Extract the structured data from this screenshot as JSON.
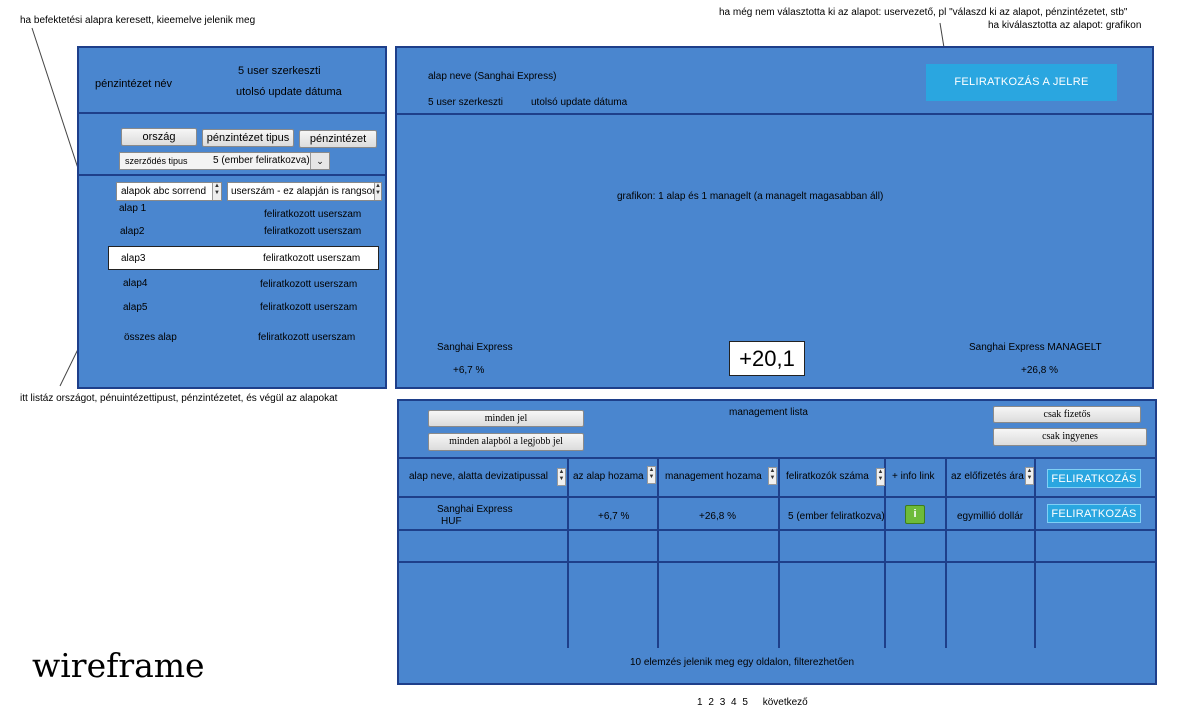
{
  "annotations": {
    "top_left": "ha befektetési alapra keresett, kieemelve jelenik meg",
    "bottom_left": "itt listáz országot, pénuintézettipust, pénzintézetet, és végül az alapokat",
    "top_right_line1": "ha még nem választotta ki az alapot: uservezető, pl \"válaszd ki az alapot, pénzintézetet, stb\"",
    "top_right_line2": "ha kiválasztotta az alapot: grafikon",
    "wireframe": "wireframe"
  },
  "left_panel": {
    "institution_name": "pénzintézet név",
    "users_edit": "5 user szerkeszti",
    "last_update": "utolsó update dátuma",
    "filters": {
      "country": "ország",
      "institution_type": "pénzintézet tipus",
      "institution": "pénzintézet",
      "contract_type_label": "szerződés tipus",
      "contract_type_value": "5 (ember feliratkozva)",
      "sort_abc": "alapok abc sorrend",
      "sort_user": "userszám - ez alapján is rangsor"
    },
    "funds": [
      {
        "name": "alap 1",
        "subs": "feliratkozott userszam"
      },
      {
        "name": "alap2",
        "subs": "feliratkozott userszam"
      },
      {
        "name": "alap3",
        "subs": "feliratkozott userszam"
      },
      {
        "name": "alap4",
        "subs": "feliratkozott userszam"
      },
      {
        "name": "alap5",
        "subs": "feliratkozott userszam"
      },
      {
        "name": "összes alap",
        "subs": "feliratkozott userszam"
      }
    ]
  },
  "right_panel": {
    "fund_name": "alap neve (Sanghai Express)",
    "users_edit": "5 user szerkeszti",
    "last_update": "utolsó update dátuma",
    "subscribe_button": "FELIRATKOZÁS A JELRE",
    "chart_note": "grafikon: 1 alap és 1 managelt (a managelt magasabban áll)",
    "left_name": "Sanghai Express",
    "left_value": "+6,7 %",
    "center_value": "+20,1",
    "right_name": "Sanghai Express MANAGELT",
    "right_value": "+26,8 %"
  },
  "management": {
    "title": "management lista",
    "btn_all": "minden jel",
    "btn_best": "minden alapból a legjobb jel",
    "btn_paid": "csak fizetős",
    "btn_free": "csak ingyenes",
    "columns": [
      "alap neve, alatta devizatipussal",
      "az alap hozama",
      "management hozama",
      "feliratkozók száma",
      "+ info link",
      "az előfizetés ára"
    ],
    "header_cta": "FELIRATKOZÁS",
    "row": {
      "name": "Sanghai Express",
      "currency": "HUF",
      "fund_return": "+6,7 %",
      "mgmt_return": "+26,8 %",
      "subscribers": "5 (ember feliratkozva)",
      "info": "i",
      "price": "egymillió dollár",
      "cta": "FELIRATKOZÁS"
    },
    "footer": "10 elemzés jelenik meg egy oldalon, filterezhetően"
  },
  "pagination": {
    "pages": [
      "1",
      "2",
      "3",
      "4",
      "5"
    ],
    "next": "következő"
  }
}
